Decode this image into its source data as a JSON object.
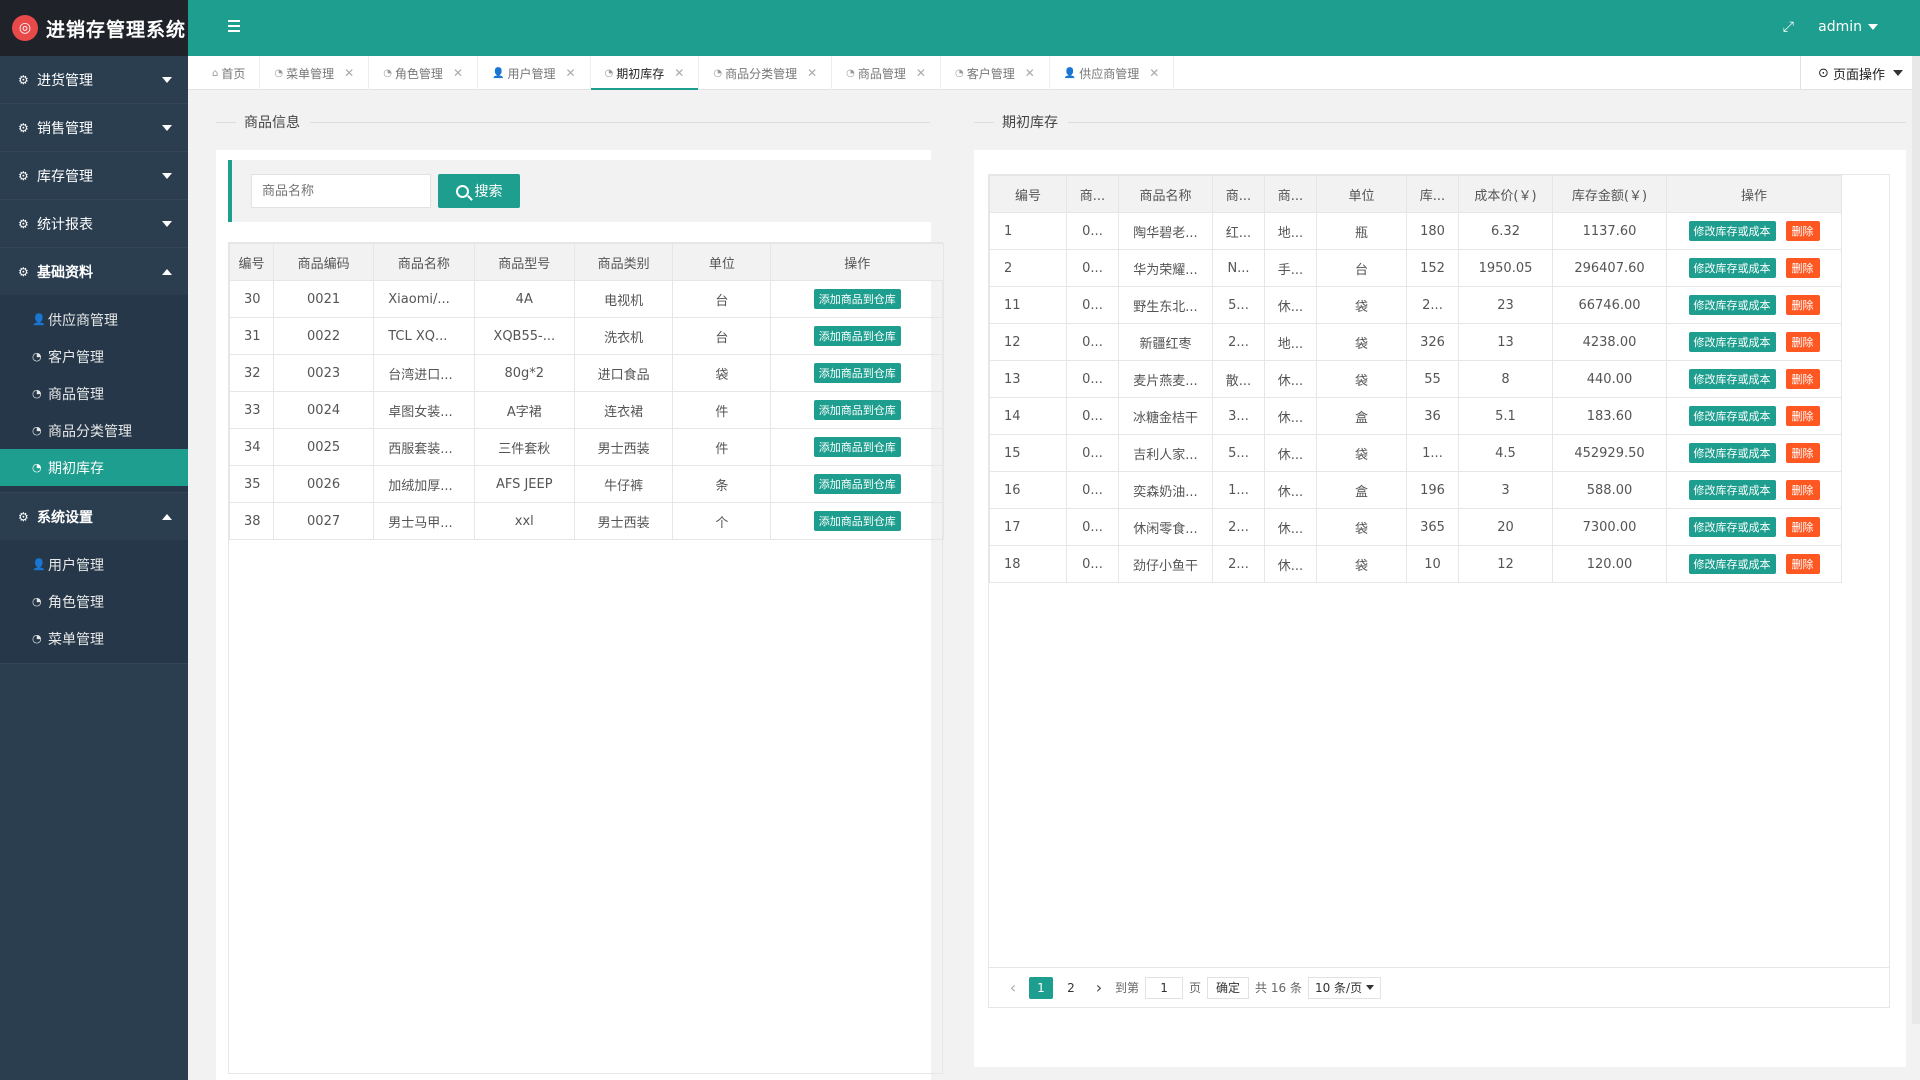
{
  "app": {
    "title": "进销存管理系统",
    "logo_glyph": "◎"
  },
  "header": {
    "user": "admin",
    "expand_glyph": "⤢"
  },
  "sidebar": {
    "groups": [
      {
        "label": "进货管理",
        "expanded": false
      },
      {
        "label": "销售管理",
        "expanded": false
      },
      {
        "label": "库存管理",
        "expanded": false
      },
      {
        "label": "统计报表",
        "expanded": false
      },
      {
        "label": "基础资料",
        "expanded": true,
        "items": [
          "供应商管理",
          "客户管理",
          "商品管理",
          "商品分类管理",
          "期初库存"
        ]
      },
      {
        "label": "系统设置",
        "expanded": true,
        "items": [
          "用户管理",
          "角色管理",
          "菜单管理"
        ]
      }
    ],
    "active_item": "期初库存"
  },
  "tabs": {
    "items": [
      "首页",
      "菜单管理",
      "角色管理",
      "用户管理",
      "期初库存",
      "商品分类管理",
      "商品管理",
      "客户管理",
      "供应商管理"
    ],
    "active": "期初库存",
    "page_ops": "页面操作"
  },
  "left": {
    "section_title": "商品信息",
    "search_placeholder": "商品名称",
    "search_label": "搜索",
    "columns": [
      "编号",
      "商品编码",
      "商品名称",
      "商品型号",
      "商品类别",
      "单位",
      "操作"
    ],
    "action_label": "添加商品到仓库",
    "rows": [
      [
        "30",
        "0021",
        "Xiaomi/...",
        "4A",
        "电视机",
        "台"
      ],
      [
        "31",
        "0022",
        "TCL XQ...",
        "XQB55-...",
        "洗衣机",
        "台"
      ],
      [
        "32",
        "0023",
        "台湾进口...",
        "80g*2",
        "进口食品",
        "袋"
      ],
      [
        "33",
        "0024",
        "卓图女装...",
        "A字裙",
        "连衣裙",
        "件"
      ],
      [
        "34",
        "0025",
        "西服套装...",
        "三件套秋",
        "男士西装",
        "件"
      ],
      [
        "35",
        "0026",
        "加绒加厚...",
        "AFS JEEP",
        "牛仔裤",
        "条"
      ],
      [
        "38",
        "0027",
        "男士马甲...",
        "xxl",
        "男士西装",
        "个"
      ]
    ]
  },
  "right": {
    "section_title": "期初库存",
    "columns": [
      "编号",
      "商...",
      "商品名称",
      "商...",
      "商...",
      "单位",
      "库...",
      "成本价(￥)",
      "库存金额(￥)",
      "操作"
    ],
    "edit_label": "修改库存或成本",
    "delete_label": "删除",
    "rows": [
      [
        "1",
        "0...",
        "陶华碧老...",
        "红...",
        "地...",
        "瓶",
        "180",
        "6.32",
        "1137.60"
      ],
      [
        "2",
        "0...",
        "华为荣耀...",
        "N...",
        "手...",
        "台",
        "152",
        "1950.05",
        "296407.60"
      ],
      [
        "11",
        "0...",
        "野生东北...",
        "5...",
        "休...",
        "袋",
        "2...",
        "23",
        "66746.00"
      ],
      [
        "12",
        "0...",
        "新疆红枣",
        "2...",
        "地...",
        "袋",
        "326",
        "13",
        "4238.00"
      ],
      [
        "13",
        "0...",
        "麦片燕麦...",
        "散...",
        "休...",
        "袋",
        "55",
        "8",
        "440.00"
      ],
      [
        "14",
        "0...",
        "冰糖金桔干",
        "3...",
        "休...",
        "盒",
        "36",
        "5.1",
        "183.60"
      ],
      [
        "15",
        "0...",
        "吉利人家...",
        "5...",
        "休...",
        "袋",
        "1...",
        "4.5",
        "452929.50"
      ],
      [
        "16",
        "0...",
        "奕森奶油...",
        "1...",
        "休...",
        "盒",
        "196",
        "3",
        "588.00"
      ],
      [
        "17",
        "0...",
        "休闲零食...",
        "2...",
        "休...",
        "袋",
        "365",
        "20",
        "7300.00"
      ],
      [
        "18",
        "0...",
        "劲仔小鱼干",
        "2...",
        "休...",
        "袋",
        "10",
        "12",
        "120.00"
      ]
    ],
    "pager": {
      "pages": [
        "1",
        "2"
      ],
      "current": "1",
      "goto_label": "到第",
      "goto_value": "1",
      "page_unit": "页",
      "ok_label": "确定",
      "total": "共 16 条",
      "per_page": "10 条/页"
    }
  },
  "colors": {
    "accent": "#1e9e8e",
    "sidebar": "#2b3e50",
    "danger": "#ff5722"
  }
}
